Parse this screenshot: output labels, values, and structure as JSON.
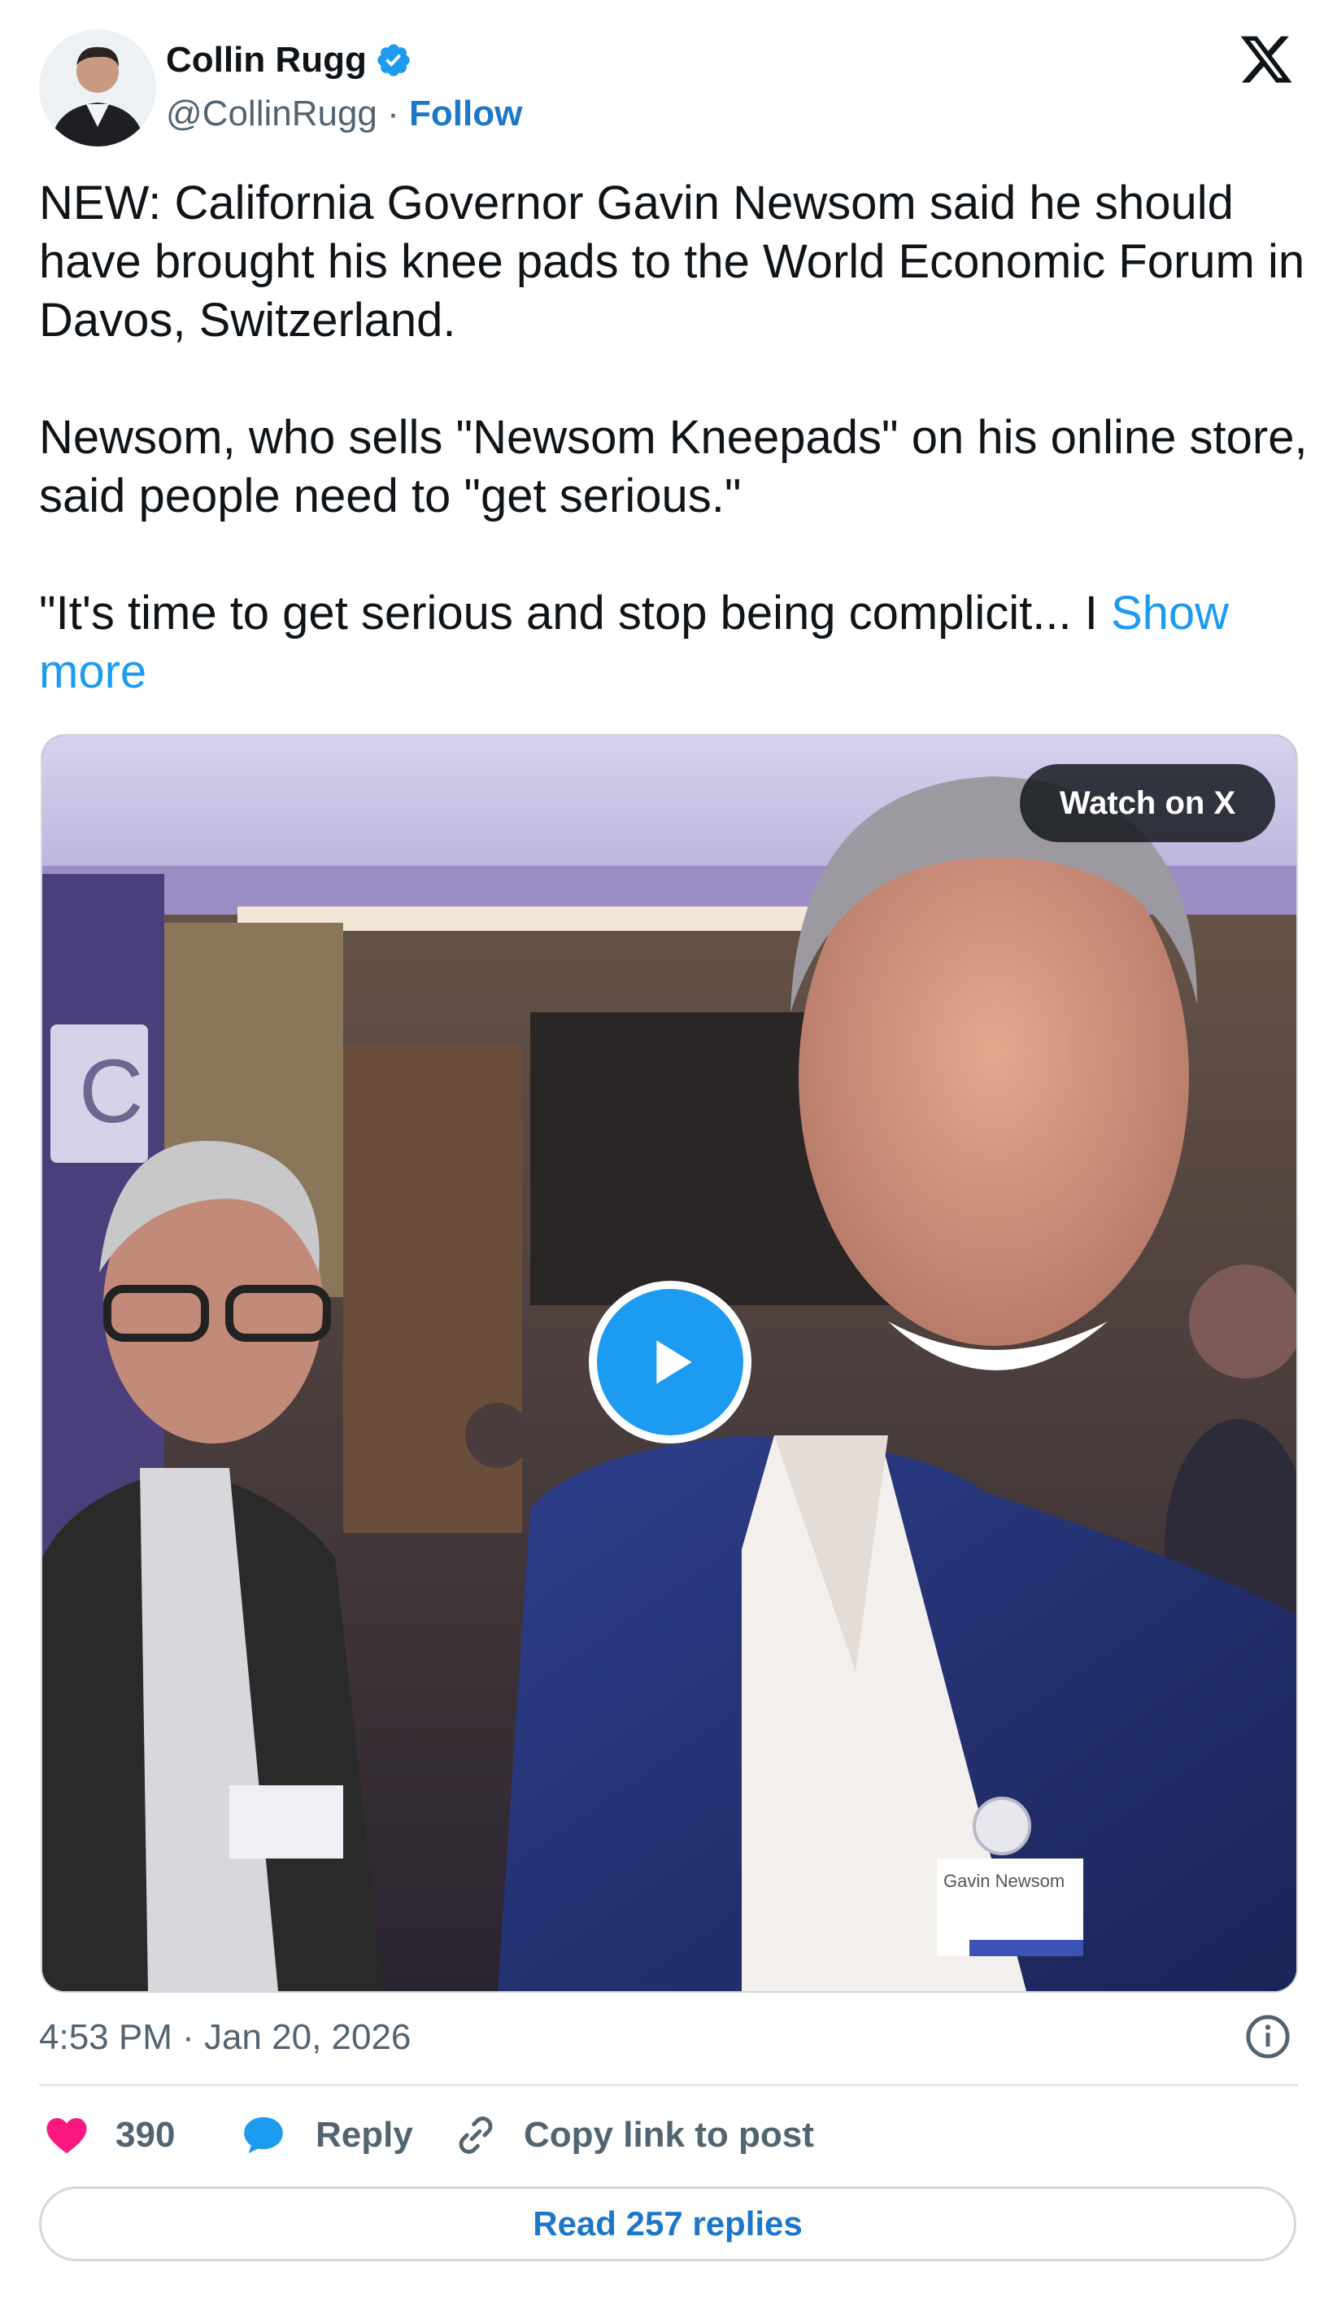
{
  "author": {
    "name": "Collin Rugg",
    "handle": "@CollinRugg",
    "separator": "·",
    "follow_label": "Follow"
  },
  "tweet": {
    "paragraph1": "NEW: California Governor Gavin Newsom said he should have brought his knee pads to the World Economic Forum in Davos, Switzerland.",
    "paragraph2": "Newsom, who sells \"Newsom Kneepads\" on his online store, said people need to \"get serious.\"",
    "paragraph3": "\"It's time to get serious and stop being complicit... I",
    "show_more": "Show more"
  },
  "media": {
    "watch_label": "Watch on X",
    "badge_text": "Gavin Newsom",
    "sign_letter": "C"
  },
  "meta": {
    "timestamp": "4:53 PM · Jan 20, 2026"
  },
  "actions": {
    "likes": "390",
    "reply_label": "Reply",
    "copy_label": "Copy link to post",
    "read_replies": "Read 257 replies"
  },
  "colors": {
    "accent": "#1d9bf0",
    "link": "#1d77c9",
    "like": "#f91880",
    "muted": "#536471"
  },
  "icons": [
    "verified-badge-icon",
    "x-logo-icon",
    "play-icon",
    "info-icon",
    "heart-icon",
    "reply-bubble-icon",
    "link-icon"
  ]
}
